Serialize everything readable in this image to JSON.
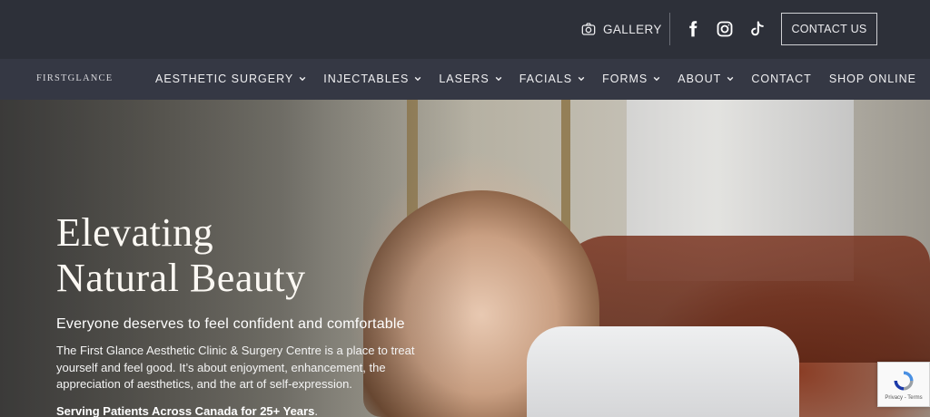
{
  "topbar": {
    "gallery_label": "GALLERY",
    "gallery_icon": "camera-icon",
    "social": [
      "facebook-icon",
      "instagram-icon",
      "tiktok-icon"
    ],
    "contact_button": "CONTACT US"
  },
  "navbar": {
    "logo": "FIRSTGLANCE",
    "items": [
      {
        "label": "AESTHETIC SURGERY",
        "dropdown": true
      },
      {
        "label": "INJECTABLES",
        "dropdown": true
      },
      {
        "label": "LASERS",
        "dropdown": true
      },
      {
        "label": "FACIALS",
        "dropdown": true
      },
      {
        "label": "FORMS",
        "dropdown": true
      },
      {
        "label": "ABOUT",
        "dropdown": true
      },
      {
        "label": "CONTACT",
        "dropdown": false
      },
      {
        "label": "SHOP ONLINE",
        "dropdown": false
      }
    ]
  },
  "hero": {
    "heading_line1": "Elevating",
    "heading_line2": "Natural Beauty",
    "subheading": "Everyone deserves to feel confident and comfortable",
    "paragraph": "The First Glance Aesthetic Clinic & Surgery Centre is a place to treat yourself and feel good. It’s about enjoyment, enhancement, the appreciation of aesthetics, and the art of self-expression.",
    "serving": "Serving Patients Across Canada for 25+ Years",
    "serving_suffix": "."
  },
  "recaptcha": {
    "text": "Privacy - Terms"
  },
  "colors": {
    "topbar_bg": "#2d3039",
    "navbar_bg": "#353844",
    "text_light": "#f0f0f2"
  }
}
